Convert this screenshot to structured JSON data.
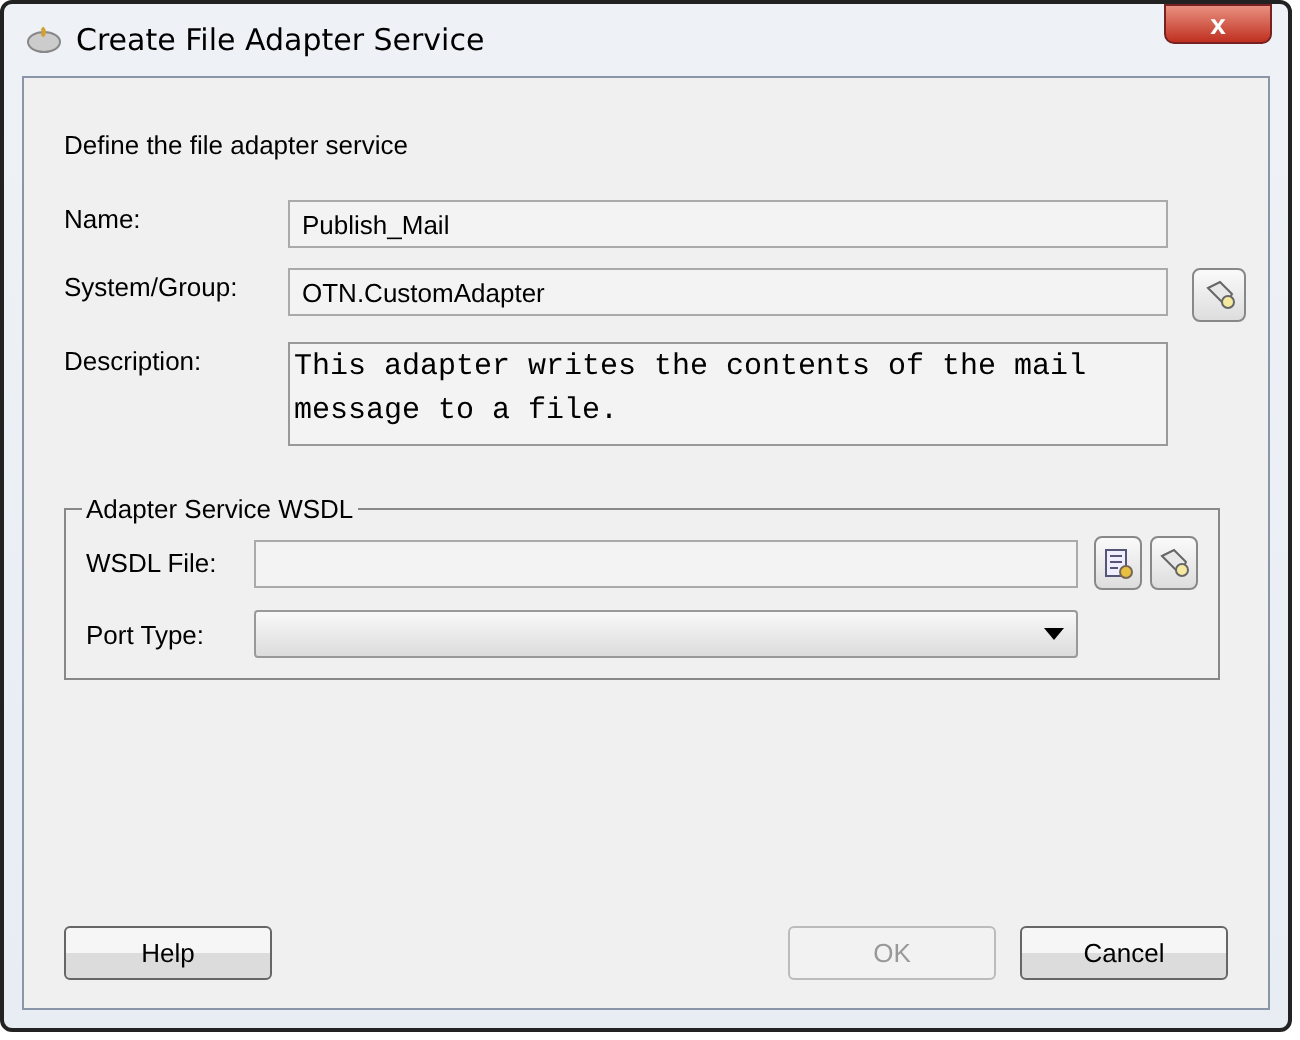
{
  "window": {
    "title": "Create File Adapter Service",
    "close": "x"
  },
  "heading": "Define the file adapter service",
  "fields": [
    {
      "label": "Name:",
      "value": "Publish_Mail",
      "kind": "text"
    },
    {
      "label": "System/Group:",
      "value": "OTN.CustomAdapter",
      "kind": "browse"
    },
    {
      "label": "Description:",
      "value": "This adapter writes the contents of the mail message to a file.",
      "kind": "area"
    }
  ],
  "wsdl": {
    "title": "Adapter Service WSDL",
    "file_label": "WSDL File:",
    "port_label": "Port Type:"
  },
  "buttons": [
    {
      "label": "Help",
      "disabled": false,
      "kind": "left"
    },
    {
      "label": "OK",
      "disabled": true,
      "kind": "right"
    },
    {
      "label": "Cancel",
      "disabled": false,
      "kind": "right"
    }
  ]
}
